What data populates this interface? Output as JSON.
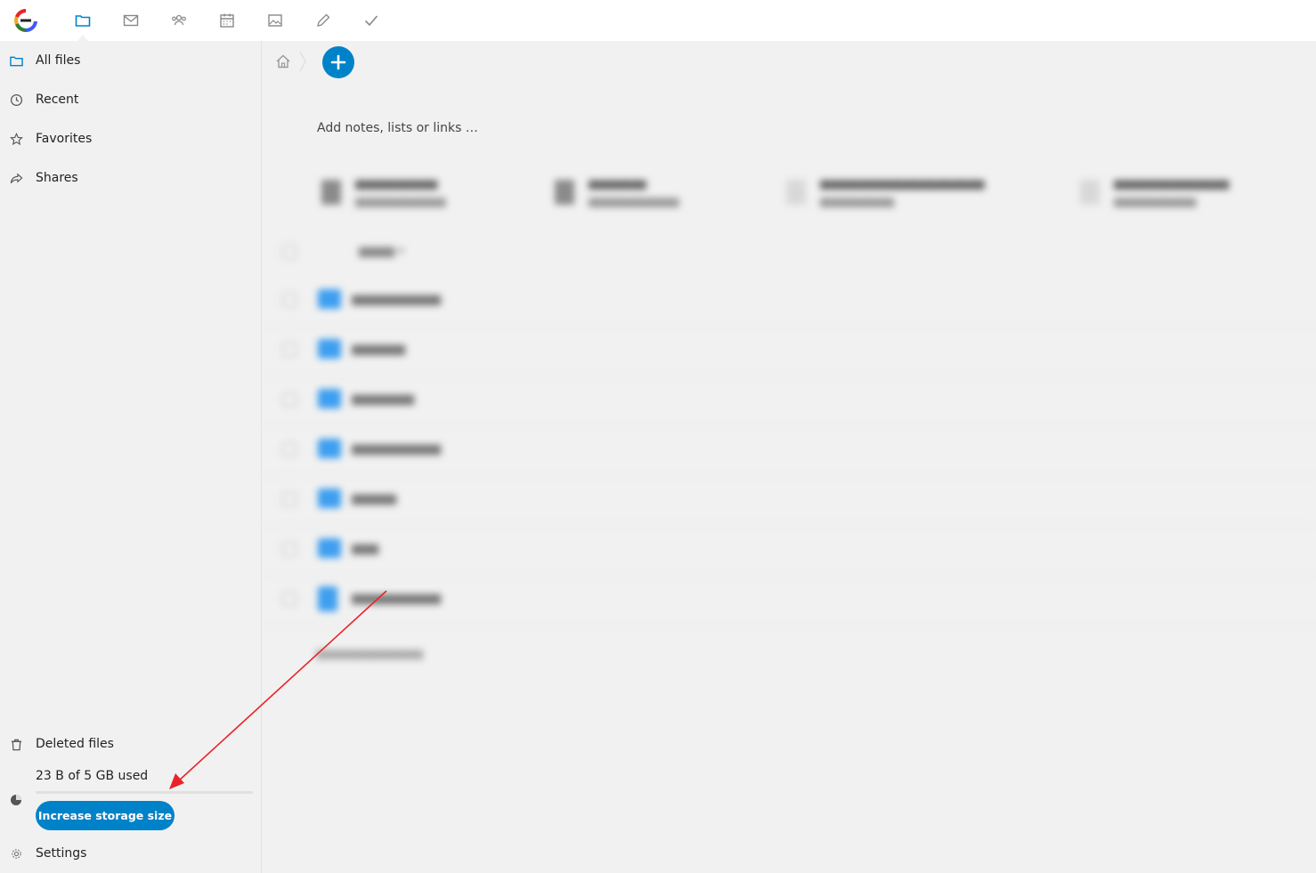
{
  "topbar": {
    "apps": [
      {
        "name": "files-app-icon",
        "active": true
      },
      {
        "name": "mail-app-icon",
        "active": false
      },
      {
        "name": "contacts-app-icon",
        "active": false
      },
      {
        "name": "calendar-app-icon",
        "active": false
      },
      {
        "name": "photos-app-icon",
        "active": false
      },
      {
        "name": "notes-app-icon",
        "active": false
      },
      {
        "name": "tasks-app-icon",
        "active": false
      }
    ]
  },
  "sidebar": {
    "items": [
      {
        "label": "All files",
        "icon": "folder-icon"
      },
      {
        "label": "Recent",
        "icon": "clock-icon"
      },
      {
        "label": "Favorites",
        "icon": "star-icon"
      },
      {
        "label": "Shares",
        "icon": "share-icon"
      }
    ],
    "deleted_label": "Deleted files",
    "quota_text": "23 B of 5 GB used",
    "quota_fraction": 0.0,
    "increase_label": "Increase storage size",
    "settings_label": "Settings"
  },
  "main": {
    "notes_placeholder": "Add notes, lists or links …"
  },
  "colors": {
    "accent": "#0082c9",
    "annotation_arrow": "#e8242a"
  }
}
